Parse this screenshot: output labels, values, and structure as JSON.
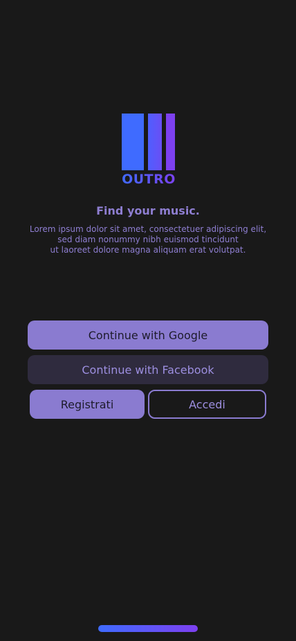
{
  "logo": {
    "wordmark": "OUTRO"
  },
  "intro": {
    "tagline": "Find your music.",
    "description_lines": [
      "Lorem ipsum dolor sit amet, consectetuer adipiscing elit,",
      "sed diam nonummy nibh euismod tincidunt",
      "ut laoreet dolore magna aliquam erat volutpat."
    ]
  },
  "actions": {
    "google_label": "Continue with Google",
    "facebook_label": "Continue with Facebook",
    "register_label": "Registrati",
    "login_label": "Accedi"
  },
  "colors": {
    "background": "#191919",
    "accent": "#8a7bd0",
    "logo_blue": "#3f6bff",
    "logo_purple": "#7d40f0"
  }
}
